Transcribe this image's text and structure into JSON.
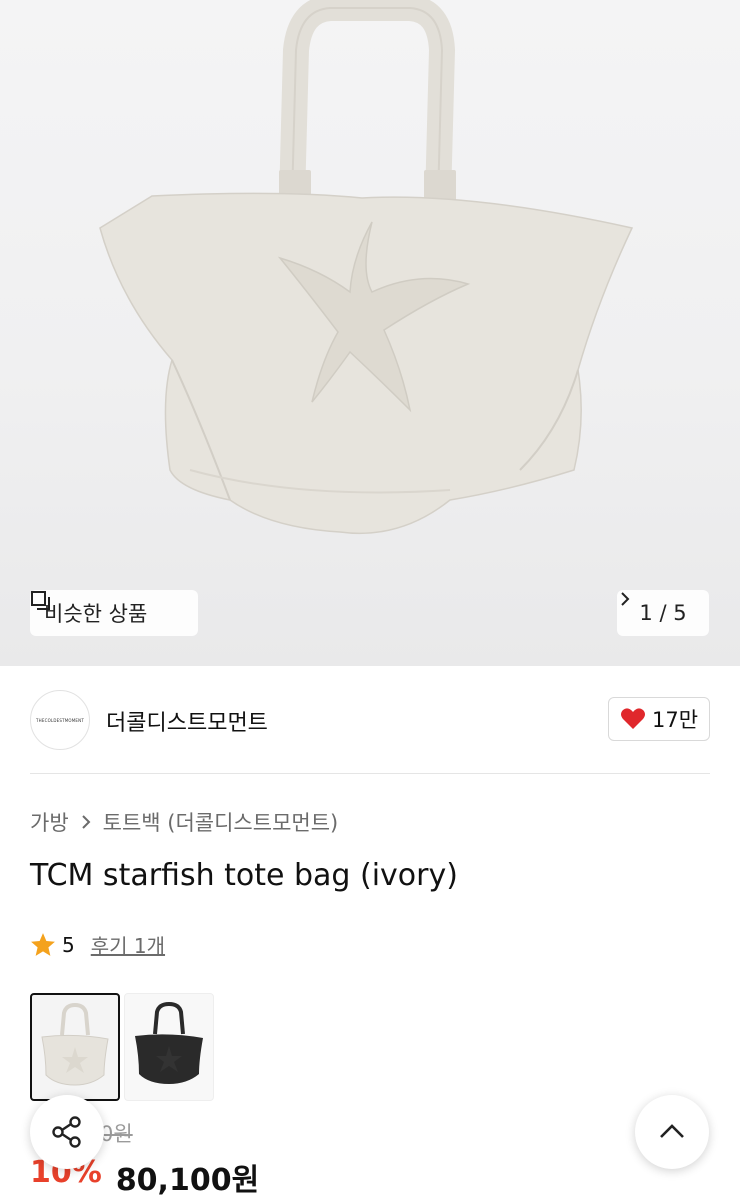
{
  "gallery": {
    "similar_label": "비슷한 상품",
    "counter": "1 / 5"
  },
  "seller": {
    "logo_text": "THECOLDESTMOMENT",
    "name": "더콜디스트모먼트",
    "likes": "17만"
  },
  "breadcrumb": {
    "category": "가방",
    "subcategory": "토트백 (더콜디스트모먼트)"
  },
  "product": {
    "title": "TCM starfish tote bag (ivory)",
    "rating": "5",
    "reviews": "후기 1개",
    "original_price": "0원",
    "discount": "10%",
    "price": "80,100원"
  },
  "colors": {
    "accent": "#e8412b",
    "heart": "#e0282c",
    "star": "#f4a21d",
    "bag_ivory": "#e6e3dc",
    "bag_black": "#2a2a2a"
  }
}
